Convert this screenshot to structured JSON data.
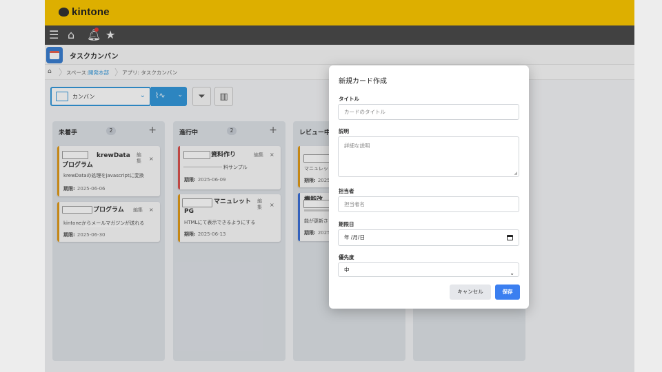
{
  "brand": {
    "name": "kintone"
  },
  "app": {
    "title": "タスクカンバン"
  },
  "breadcrumb": {
    "space_label": "スペース: ",
    "space_link": "開発本部",
    "app_label": "アプリ: タスクカンバン"
  },
  "toolbar": {
    "view_label": "カンバン"
  },
  "columns": [
    {
      "title": "未着手",
      "count": "2",
      "add": "+",
      "cards": [
        {
          "title": "krewDataプログラム",
          "edit": "編集",
          "close": "×",
          "desc": "krewDataの処理をjavascriptに変換",
          "due_label": "期限:",
          "due": "2025-06-06",
          "accent": "#e09a1a"
        },
        {
          "title": "プログラム",
          "edit": "編集",
          "close": "×",
          "desc": "kintoneからメールマガジンが送れる",
          "due_label": "期限:",
          "due": "2025-06-30",
          "accent": "#e09a1a"
        }
      ]
    },
    {
      "title": "進行中",
      "count": "2",
      "add": "+",
      "cards": [
        {
          "title": "資料作り",
          "edit": "編集",
          "close": "×",
          "desc": "料サンプル",
          "due_label": "期限:",
          "due": "2025-06-09",
          "accent": "#d9534f"
        },
        {
          "title": "マニュレットPG",
          "edit": "編集",
          "close": "×",
          "desc": "HTMLにて表示できるようにする",
          "due_label": "期限:",
          "due": "2025-06-13",
          "accent": "#e09a1a"
        }
      ]
    },
    {
      "title": "レビュー中",
      "count": "",
      "add": "",
      "cards": [
        {
          "title": "",
          "desc": "マニュレッ",
          "due_label": "期限:",
          "due": "2025",
          "accent": "#e09a1a"
        },
        {
          "title": "機能改",
          "desc": "能が更新さ",
          "due_label": "期限:",
          "due": "2025",
          "accent": "#3b6fd6"
        }
      ]
    }
  ],
  "modal": {
    "title": "新規カード作成",
    "title_label": "タイトル",
    "title_placeholder": "カードのタイトル",
    "desc_label": "説明",
    "desc_placeholder": "詳細な説明",
    "assignee_label": "担当者",
    "assignee_placeholder": "担当者名",
    "due_label": "期限日",
    "due_placeholder": "年 /月/日",
    "priority_label": "優先度",
    "priority_value": "中",
    "cancel": "キャンセル",
    "save": "保存"
  },
  "colors": {
    "topbar": "#fcc800",
    "navbar": "#4b4b4b",
    "accent_blue": "#3498db",
    "save_button": "#3b7ff0"
  }
}
